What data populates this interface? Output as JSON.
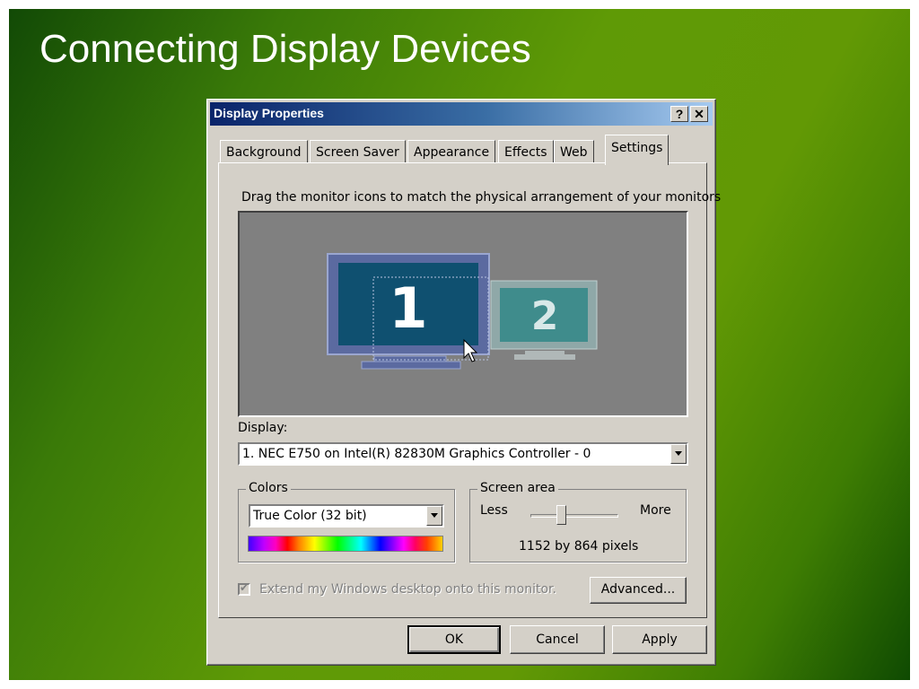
{
  "slide": {
    "title": "Connecting Display Devices"
  },
  "window": {
    "title": "Display Properties",
    "help_button": "?",
    "close_button": "✕"
  },
  "tabs": [
    {
      "label": "Background",
      "active": false
    },
    {
      "label": "Screen Saver",
      "active": false
    },
    {
      "label": "Appearance",
      "active": false
    },
    {
      "label": "Effects",
      "active": false
    },
    {
      "label": "Web",
      "active": false
    },
    {
      "label": "Settings",
      "active": true
    }
  ],
  "settings": {
    "instruction": "Drag the monitor icons to match the physical arrangement of your monitors",
    "monitors": [
      {
        "number": "1",
        "primary": true
      },
      {
        "number": "2",
        "primary": false
      }
    ],
    "display_label": "Display:",
    "display_value": "1. NEC E750 on Intel(R) 82830M Graphics Controller - 0",
    "colors": {
      "legend": "Colors",
      "value": "True Color (32 bit)"
    },
    "screen_area": {
      "legend": "Screen area",
      "less_label": "Less",
      "more_label": "More",
      "resolution": "1152 by 864 pixels"
    },
    "extend_checkbox": {
      "label": "Extend my Windows desktop onto this monitor.",
      "checked": true,
      "enabled": false
    },
    "advanced_button": "Advanced..."
  },
  "buttons": {
    "ok": "OK",
    "cancel": "Cancel",
    "apply": "Apply"
  },
  "colors": {
    "titlebar_start": "#0a246a",
    "titlebar_end": "#a6caf0",
    "dialog_face": "#d4d0c8",
    "monitor_1_screen": "#0f5070",
    "monitor_2_screen": "#3f8c8c"
  }
}
